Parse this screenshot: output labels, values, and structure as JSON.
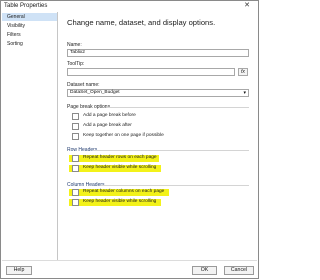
{
  "window": {
    "title": "Table Properties",
    "close_glyph": "✕"
  },
  "sidebar": {
    "items": [
      {
        "label": "General",
        "selected": true
      },
      {
        "label": "Visibility",
        "selected": false
      },
      {
        "label": "Filters",
        "selected": false
      },
      {
        "label": "Sorting",
        "selected": false
      }
    ]
  },
  "main": {
    "heading": "Change name, dataset, and display options.",
    "name_label": "Name:",
    "name_value": "Tablix2",
    "tooltip_label": "ToolTip:",
    "tooltip_value": "",
    "fx_label": "fx",
    "dataset_label": "Dataset name:",
    "dataset_value": "DataSet_Open_Budget",
    "page_break": {
      "title": "Page break options",
      "options": [
        "Add a page break before",
        "Add a page break after",
        "Keep together on one page if possible"
      ]
    },
    "row_headers": {
      "title": "Row Headers",
      "options": [
        "Repeat header rows on each page",
        "Keep header visible while scrolling"
      ]
    },
    "column_headers": {
      "title": "Column Headers",
      "options": [
        "Repeat header columns on each page",
        "Keep header visible while scrolling"
      ]
    }
  },
  "footer": {
    "help": "Help",
    "ok": "OK",
    "cancel": "Cancel"
  },
  "colors": {
    "highlight": "#f3f21a",
    "selected_nav": "#cfe2f6"
  }
}
